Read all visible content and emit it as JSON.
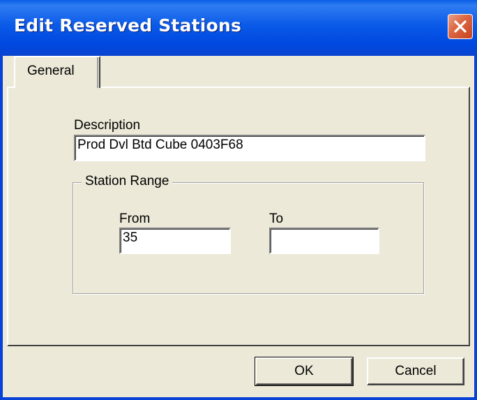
{
  "window": {
    "title": "Edit Reserved Stations",
    "close_icon": "close-icon"
  },
  "tabs": [
    {
      "label": "General",
      "selected": true
    }
  ],
  "form": {
    "description_label": "Description",
    "description_value": "Prod Dvl Btd Cube 0403F68",
    "station_range": {
      "legend": "Station Range",
      "from_label": "From",
      "from_value": "35",
      "to_label": "To",
      "to_value": ""
    }
  },
  "buttons": {
    "ok_label": "OK",
    "cancel_label": "Cancel"
  },
  "colors": {
    "titlebar": "#0a5ae8",
    "close_button": "#dd6a44",
    "face": "#ece9d8"
  }
}
